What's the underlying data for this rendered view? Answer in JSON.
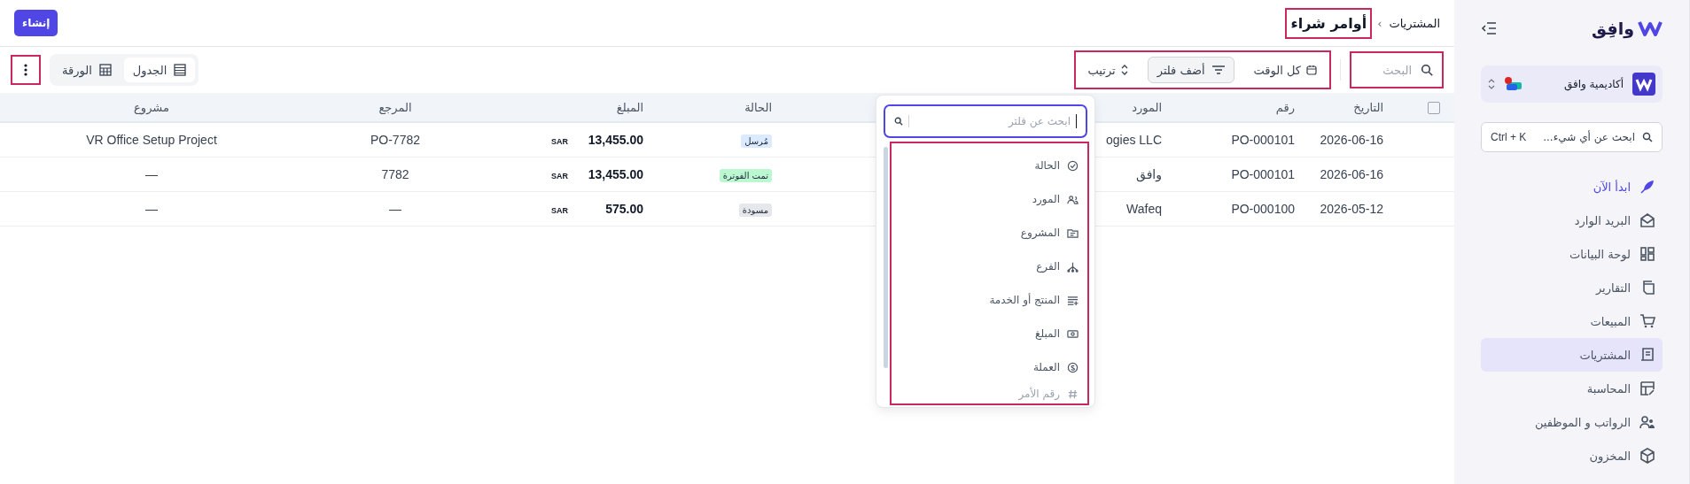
{
  "sidebar": {
    "brand": "وافِق",
    "org": {
      "name": "أكاديمية وافق",
      "notification": true
    },
    "search": {
      "placeholder": "ابحث عن أي شيء...",
      "shortcut": "Ctrl + K"
    },
    "items": [
      {
        "label": "ابدأ الآن",
        "selected": false,
        "accent": true
      },
      {
        "label": "البريد الوارد",
        "selected": false,
        "accent": false
      },
      {
        "label": "لوحة البيانات",
        "selected": false,
        "accent": false
      },
      {
        "label": "التقارير",
        "selected": false,
        "accent": false
      },
      {
        "label": "المبيعات",
        "selected": false,
        "accent": false
      },
      {
        "label": "المشتريات",
        "selected": true,
        "accent": false
      },
      {
        "label": "المحاسبة",
        "selected": false,
        "accent": false
      },
      {
        "label": "الرواتب و الموظفين",
        "selected": false,
        "accent": false
      },
      {
        "label": "المخزون",
        "selected": false,
        "accent": false
      }
    ]
  },
  "header": {
    "breadcrumb": "المشتريات",
    "separator": "›",
    "title": "أوامر شراء",
    "title_highlighted": true,
    "create_button": "إنشاء"
  },
  "toolbar": {
    "search": {
      "placeholder": "البحث",
      "highlighted": true
    },
    "filters_highlighted": true,
    "period": "كل الوقت",
    "add_filter": "أضف فلتر",
    "sort": "ترتيب",
    "views": [
      {
        "label": "الجدول",
        "selected": true
      },
      {
        "label": "الورقة",
        "selected": false
      }
    ],
    "more_highlighted": true
  },
  "table": {
    "select_all_checked": false,
    "columns": [
      "التاريخ",
      "رقم",
      "المورد",
      "",
      "الحالة",
      "المبلغ",
      "المرجع",
      "مشروع"
    ],
    "rows": [
      {
        "date": "2026-06-16",
        "number": "PO-000101",
        "vendor": "ogies LLC",
        "status": {
          "text": "مُرسل",
          "color": "#dbeafe"
        },
        "currency": "SAR",
        "amount": "13,455.00",
        "reference": "PO-7782",
        "project": "VR Office Setup Project"
      },
      {
        "date": "2026-06-16",
        "number": "PO-000101",
        "vendor": "وافق",
        "status": {
          "text": "تمت الفوترة",
          "color": "#bbf7d0"
        },
        "currency": "SAR",
        "amount": "13,455.00",
        "reference": "7782",
        "project": "—"
      },
      {
        "date": "2026-05-12",
        "number": "PO-000100",
        "vendor": "Wafeq",
        "status": {
          "text": "مسودة",
          "color": "#e5e7eb"
        },
        "currency": "SAR",
        "amount": "575.00",
        "reference": "—",
        "project": "—"
      }
    ]
  },
  "filter_menu": {
    "placeholder": "ابحث عن فلتر",
    "list_highlighted": true,
    "items": [
      {
        "label": "الحالة",
        "faded": false
      },
      {
        "label": "المورد",
        "faded": false
      },
      {
        "label": "المشروع",
        "faded": false
      },
      {
        "label": "الفرع",
        "faded": false
      },
      {
        "label": "المنتج أو الخدمة",
        "faded": false
      },
      {
        "label": "المبلغ",
        "faded": false
      },
      {
        "label": "العملة",
        "faded": false
      },
      {
        "label": "رقم الأمر",
        "faded": true
      }
    ]
  }
}
